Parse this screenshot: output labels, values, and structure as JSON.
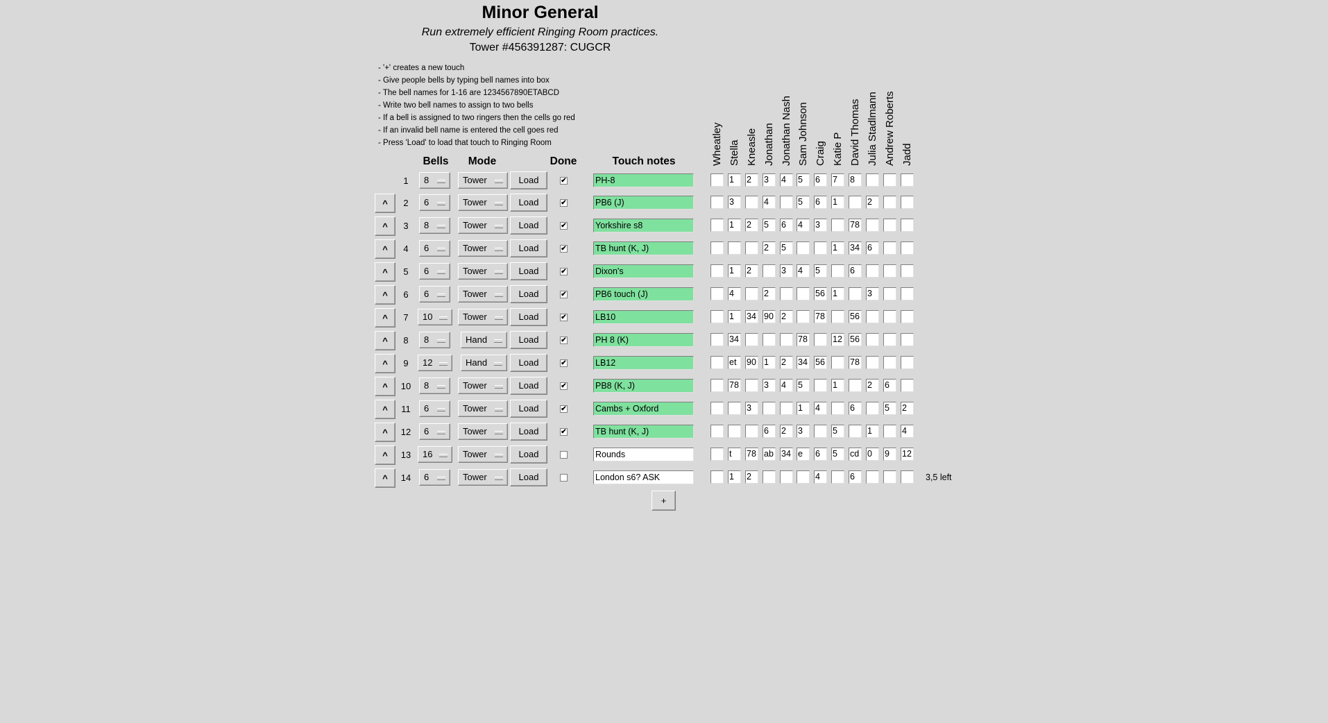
{
  "header": {
    "title": "Minor General",
    "subtitle": "Run extremely efficient Ringing Room practices.",
    "tower": "Tower #456391287: CUGCR"
  },
  "instructions": [
    "- '+' creates a new touch",
    "- Give people bells by typing bell names into box",
    "- The bell names for 1-16 are 1234567890ETABCD",
    "- Write two bell names to assign to two bells",
    "- If a bell is assigned to two ringers then the cells go red",
    "- If an invalid bell name is entered the cell goes red",
    "- Press 'Load' to load that touch to Ringing Room"
  ],
  "columns": {
    "bells": "Bells",
    "mode": "Mode",
    "done": "Done",
    "notes": "Touch notes"
  },
  "ringers": [
    "Wheatley",
    "Stella",
    "Kneasle",
    "Jonathan",
    "Jonathan Nash",
    "Sam Johnson",
    "Craig",
    "Katie P",
    "David Thomas",
    "Julia Stadlmann",
    "Andrew Roberts",
    "Jadd"
  ],
  "up_label": "^",
  "load_label": "Load",
  "check_mark": "✔",
  "add_button": "+",
  "colors": {
    "done_note": "#7fe19e",
    "background": "#d9d9d9"
  },
  "touches": [
    {
      "n": "1",
      "bells": "8",
      "mode": "Tower",
      "done": true,
      "notes": "PH-8",
      "cells": [
        "",
        "1",
        "2",
        "3",
        "4",
        "5",
        "6",
        "7",
        "8",
        "",
        "",
        ""
      ],
      "extra": ""
    },
    {
      "n": "2",
      "bells": "6",
      "mode": "Tower",
      "done": true,
      "notes": "PB6 (J)",
      "cells": [
        "",
        "3",
        "",
        "4",
        "",
        "5",
        "6",
        "1",
        "",
        "2",
        "",
        ""
      ],
      "extra": ""
    },
    {
      "n": "3",
      "bells": "8",
      "mode": "Tower",
      "done": true,
      "notes": "Yorkshire s8",
      "cells": [
        "",
        "1",
        "2",
        "5",
        "6",
        "4",
        "3",
        "",
        "78",
        "",
        "",
        ""
      ],
      "extra": ""
    },
    {
      "n": "4",
      "bells": "6",
      "mode": "Tower",
      "done": true,
      "notes": "TB hunt (K, J)",
      "cells": [
        "",
        "",
        "",
        "2",
        "5",
        "",
        "",
        "1",
        "34",
        "6",
        "",
        ""
      ],
      "extra": ""
    },
    {
      "n": "5",
      "bells": "6",
      "mode": "Tower",
      "done": true,
      "notes": "Dixon's",
      "cells": [
        "",
        "1",
        "2",
        "",
        "3",
        "4",
        "5",
        "",
        "6",
        "",
        "",
        ""
      ],
      "extra": ""
    },
    {
      "n": "6",
      "bells": "6",
      "mode": "Tower",
      "done": true,
      "notes": "PB6 touch (J)",
      "cells": [
        "",
        "4",
        "",
        "2",
        "",
        "",
        "56",
        "1",
        "",
        "3",
        "",
        ""
      ],
      "extra": ""
    },
    {
      "n": "7",
      "bells": "10",
      "mode": "Tower",
      "done": true,
      "notes": "LB10",
      "cells": [
        "",
        "1",
        "34",
        "90",
        "2",
        "",
        "78",
        "",
        "56",
        "",
        "",
        ""
      ],
      "extra": ""
    },
    {
      "n": "8",
      "bells": "8",
      "mode": "Hand",
      "done": true,
      "notes": "PH 8 (K)",
      "cells": [
        "",
        "34",
        "",
        "",
        "",
        "78",
        "",
        "12",
        "56",
        "",
        "",
        ""
      ],
      "extra": ""
    },
    {
      "n": "9",
      "bells": "12",
      "mode": "Hand",
      "done": true,
      "notes": "LB12",
      "cells": [
        "",
        "et",
        "90",
        "1",
        "2",
        "34",
        "56",
        "",
        "78",
        "",
        "",
        ""
      ],
      "extra": ""
    },
    {
      "n": "10",
      "bells": "8",
      "mode": "Tower",
      "done": true,
      "notes": "PB8 (K, J)",
      "cells": [
        "",
        "78",
        "",
        "3",
        "4",
        "5",
        "",
        "1",
        "",
        "2",
        "6",
        ""
      ],
      "extra": ""
    },
    {
      "n": "11",
      "bells": "6",
      "mode": "Tower",
      "done": true,
      "notes": "Cambs + Oxford",
      "cells": [
        "",
        "",
        "3",
        "",
        "",
        "1",
        "4",
        "",
        "6",
        "",
        "5",
        "2"
      ],
      "extra": ""
    },
    {
      "n": "12",
      "bells": "6",
      "mode": "Tower",
      "done": true,
      "notes": "TB hunt (K, J)",
      "cells": [
        "",
        "",
        "",
        "6",
        "2",
        "3",
        "",
        "5",
        "",
        "1",
        "",
        "4"
      ],
      "extra": ""
    },
    {
      "n": "13",
      "bells": "16",
      "mode": "Tower",
      "done": false,
      "notes": "Rounds",
      "cells": [
        "",
        "t",
        "78",
        "ab",
        "34",
        "e",
        "6",
        "5",
        "cd",
        "0",
        "9",
        "12"
      ],
      "extra": ""
    },
    {
      "n": "14",
      "bells": "6",
      "mode": "Tower",
      "done": false,
      "notes": "London s6? ASK",
      "cells": [
        "",
        "1",
        "2",
        "",
        "",
        "",
        "4",
        "",
        "6",
        "",
        "",
        ""
      ],
      "extra": "3,5 left"
    }
  ]
}
